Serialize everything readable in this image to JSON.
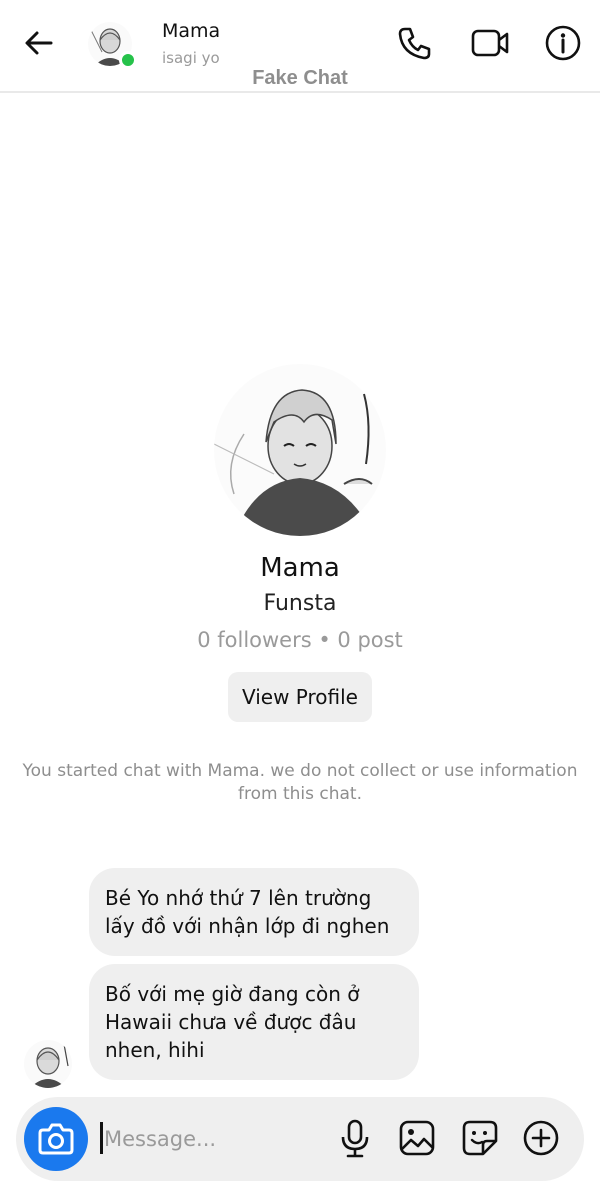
{
  "header": {
    "name": "Mama",
    "subtitle": "isagi yo",
    "status_color": "#25c24a"
  },
  "watermark": "Fake Chat",
  "profile": {
    "name": "Mama",
    "type": "Funsta",
    "stats": "0 followers • 0 post",
    "view_profile_label": "View Profile"
  },
  "started_note": "You started chat with Mama. we do not collect or use information from this chat.",
  "messages": [
    {
      "text": "Bé Yo nhớ thứ 7 lên trường lấy đồ với nhận lớp đi nghen"
    },
    {
      "text": "Bố với mẹ giờ đang còn ở Hawaii chưa về được đâu nhen, hihi"
    }
  ],
  "composer": {
    "placeholder": "Message...",
    "accent_color": "#1a79ee"
  },
  "icons": {
    "back": "arrow-left-icon",
    "call": "phone-icon",
    "video": "video-camera-icon",
    "info": "info-icon",
    "camera": "camera-icon",
    "mic": "microphone-icon",
    "gallery": "image-icon",
    "sticker": "sticker-icon",
    "plus": "plus-circle-icon"
  }
}
